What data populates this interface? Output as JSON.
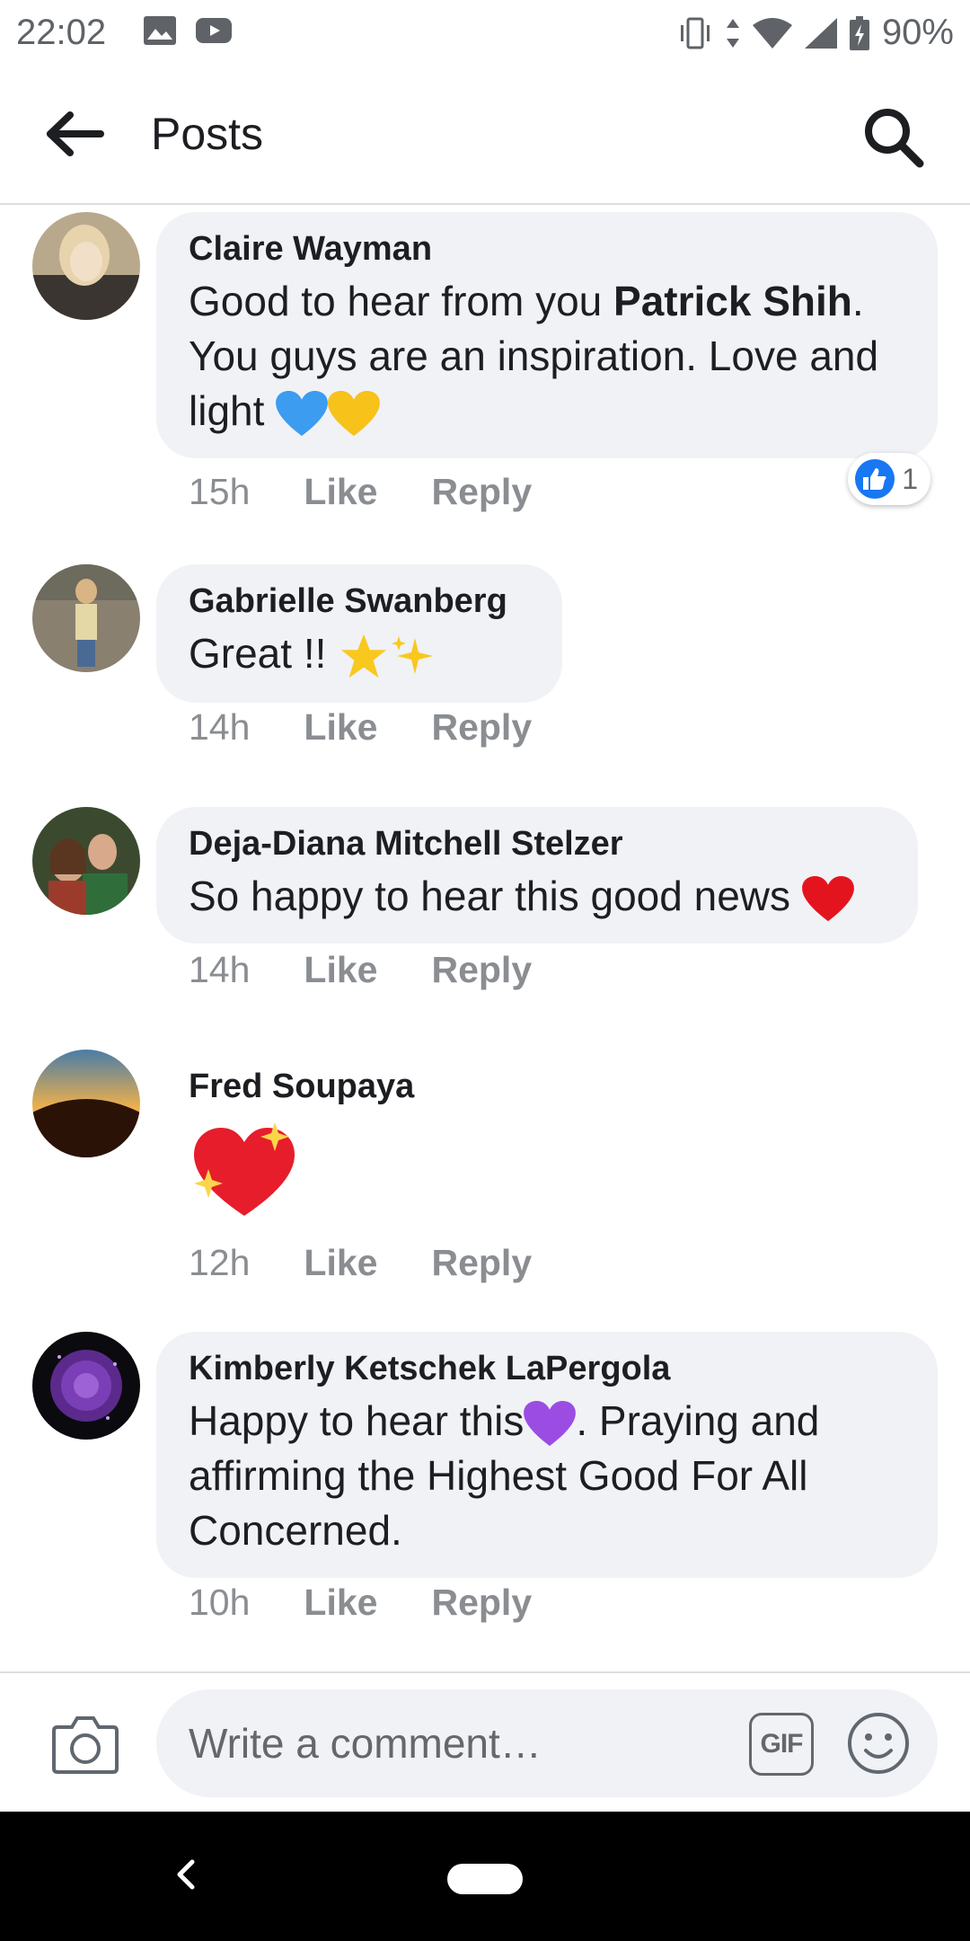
{
  "status_bar": {
    "time": "22:02",
    "battery": "90%",
    "icons": [
      "gallery-icon",
      "youtube-icon",
      "vibrate-icon",
      "data-arrows-icon",
      "wifi-icon",
      "signal-icon",
      "battery-icon"
    ]
  },
  "app_bar": {
    "title": "Posts",
    "back_icon": "back-arrow-icon",
    "search_icon": "search-icon"
  },
  "comments": [
    {
      "author": "Claire Wayman",
      "text_before": "Good to hear from you ",
      "mention": "Patrick Shih",
      "text_after": ". You guys are an inspiration. Love and light",
      "emojis": [
        "blue-heart",
        "yellow-heart"
      ],
      "time": "15h",
      "like_label": "Like",
      "reply_label": "Reply",
      "reaction_count": "1"
    },
    {
      "author": "Gabrielle Swanberg",
      "text": "Great !!",
      "emojis": [
        "glowing-star",
        "sparkles"
      ],
      "time": "14h",
      "like_label": "Like",
      "reply_label": "Reply"
    },
    {
      "author": "Deja-Diana Mitchell Stelzer",
      "text": "So happy to hear this good news",
      "emojis": [
        "red-heart"
      ],
      "time": "14h",
      "like_label": "Like",
      "reply_label": "Reply"
    },
    {
      "author": "Fred Soupaya",
      "emojis": [
        "sparkling-heart"
      ],
      "time": "12h",
      "like_label": "Like",
      "reply_label": "Reply"
    },
    {
      "author": "Kimberly Ketschek LaPergola",
      "text_before": "Happy to hear this",
      "text_after": ". Praying and affirming the Highest Good For All Concerned.",
      "emojis": [
        "purple-heart"
      ],
      "time": "10h",
      "like_label": "Like",
      "reply_label": "Reply"
    }
  ],
  "composer": {
    "placeholder": "Write a comment…",
    "gif_label": "GIF"
  },
  "colors": {
    "bubble": "#f0f2f5",
    "meta": "#8a8d91",
    "like_blue": "#1877f2"
  }
}
